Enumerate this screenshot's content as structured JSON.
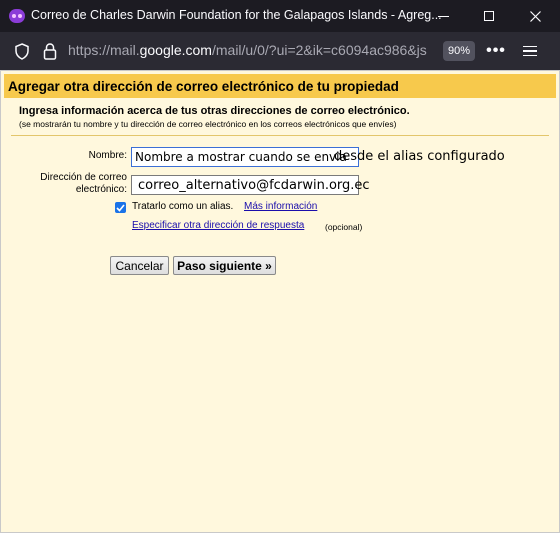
{
  "window": {
    "title": "Correo de Charles Darwin Foundation for the Galapagos Islands - Agreg...",
    "minimize_icon": "minimize-icon",
    "maximize_icon": "maximize-icon",
    "close_icon": "close-icon"
  },
  "navbar": {
    "url_prefix": "https://mail.",
    "url_domain": "google.com",
    "url_suffix": "/mail/u/0/?ui=2&ik=c6094ac986&js",
    "zoom": "90%",
    "more_glyph": "•••"
  },
  "page": {
    "title": "Agregar otra dirección de correo electrónico de tu propiedad",
    "intro": "Ingresa información acerca de tus otras direcciones de correo electrónico.",
    "intro_sub": "(se mostrarán tu nombre y tu dirección de correo electrónico en los correos electrónicos que envíes)",
    "nombre_label": "Nombre:",
    "nombre_value": "Nombre a mostrar cuando se envia",
    "nombre_overflow": "desde el alias configurado",
    "email_label_line1": "Dirección de correo",
    "email_label_line2": "electrónico:",
    "email_value": "correo_alternativo@fcdarwin.org.ec",
    "alias_checked": true,
    "alias_label": "Tratarlo como un alias.",
    "more_info_link": "Más información",
    "reply_link": "Especificar otra dirección de respuesta",
    "optional": "(opcional)",
    "cancel_button": "Cancelar",
    "next_button": "Paso siguiente »"
  },
  "colors": {
    "header_band": "#f7c94c",
    "page_bg": "#fff8dd",
    "link": "#1a0dab",
    "checkbox": "#1a73e8",
    "browser_chrome": "#2b2a33"
  }
}
